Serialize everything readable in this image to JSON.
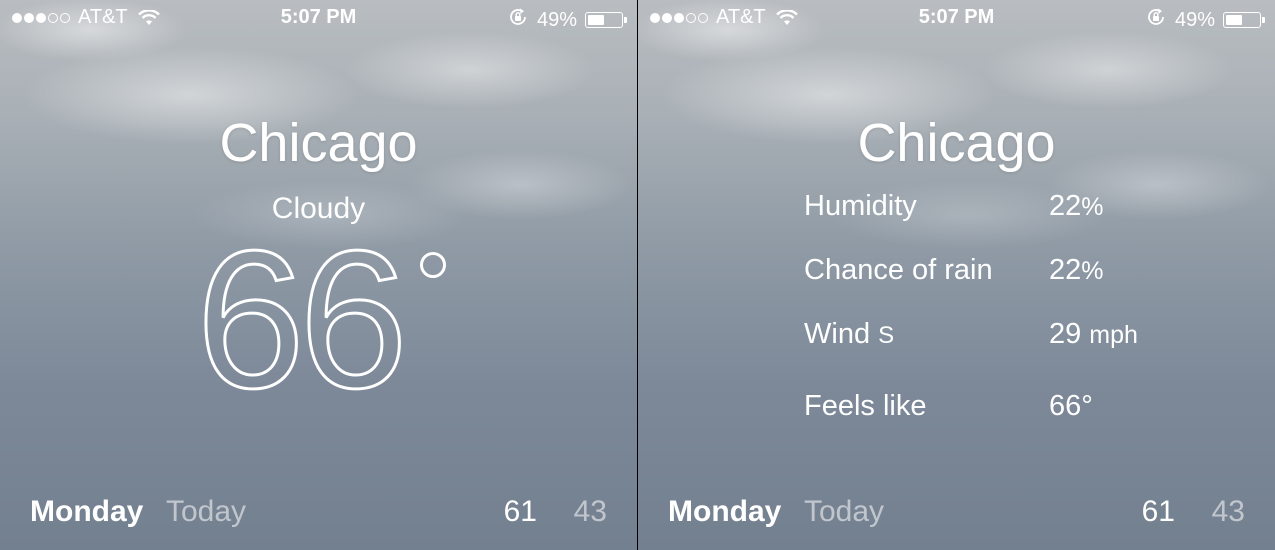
{
  "status_bar": {
    "carrier": "AT&T",
    "time": "5:07 PM",
    "battery": "49%",
    "battery_level": 0.49,
    "signal_bars": 3,
    "signal_total": 5,
    "icons": [
      "signal-dots-icon",
      "wifi-icon",
      "rotation-lock-icon",
      "battery-icon"
    ]
  },
  "left_screen": {
    "city": "Chicago",
    "condition": "Cloudy",
    "temperature": "66"
  },
  "right_screen": {
    "city": "Chicago",
    "details": [
      {
        "label": "Humidity",
        "value": "22",
        "unit": "%"
      },
      {
        "label": "Chance of rain",
        "value": "22",
        "unit": "%"
      },
      {
        "label": "Wind",
        "direction": "S",
        "value": "29",
        "unit": "mph"
      },
      {
        "label": "Feels like",
        "value": "66°",
        "unit": ""
      }
    ]
  },
  "forecast": {
    "day": "Monday",
    "day_label": "Today",
    "high": "61",
    "low": "43"
  },
  "colors": {
    "text": "#ffffff",
    "muted_text": "#c8ced6",
    "sky_top": "#b9bdc1",
    "sky_bottom": "#73808f"
  }
}
